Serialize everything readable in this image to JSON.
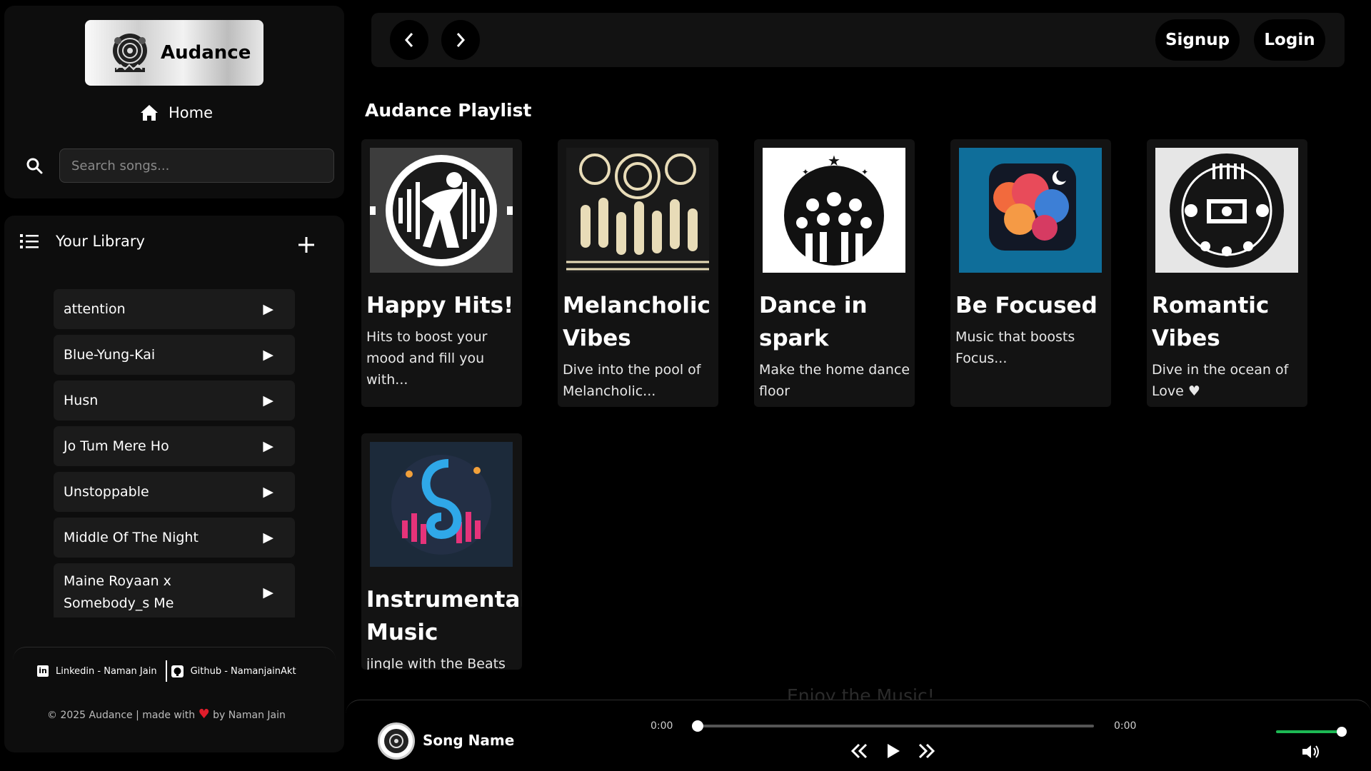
{
  "app": {
    "brand": "Audance"
  },
  "sidebar": {
    "home_label": "Home",
    "search_placeholder": "Search songs...",
    "library_label": "Your Library",
    "songs": [
      {
        "title": "attention"
      },
      {
        "title": "Blue-Yung-Kai"
      },
      {
        "title": "Husn"
      },
      {
        "title": "Jo Tum Mere Ho"
      },
      {
        "title": "Unstoppable"
      },
      {
        "title": "Middle Of The Night"
      },
      {
        "title": "Maine Royaan x Somebody_s Me"
      }
    ],
    "linkedin_label": "Linkedin - Naman Jain",
    "github_label": "Github - NamanjainAkt",
    "copyright_pre": "© 2025 Audance | made with",
    "copyright_heart": "♥",
    "copyright_post": "by Naman Jain"
  },
  "topbar": {
    "signup_label": "Signup",
    "login_label": "Login"
  },
  "main": {
    "section_title": "Audance Playlist",
    "playlists": [
      {
        "title": "Happy Hits!",
        "desc": "Hits to boost your mood and fill you with..."
      },
      {
        "title": "Melancholic Vibes",
        "desc": "Dive into the pool of Melancholic..."
      },
      {
        "title": "Dance in spark",
        "desc": "Make the home dance floor"
      },
      {
        "title": "Be Focused",
        "desc": "Music that boosts Focus..."
      },
      {
        "title": "Romantic Vibes",
        "desc": "Dive in the ocean of Love ♥"
      },
      {
        "title": "Instrumental Music",
        "desc": "jingle with the Beats"
      }
    ],
    "faded_text": "Enjoy the Music!"
  },
  "player": {
    "song_name": "Song Name",
    "current_time": "0:00",
    "duration": "0:00",
    "progress": 0,
    "volume": 1.0,
    "accent_color": "#1db954"
  }
}
